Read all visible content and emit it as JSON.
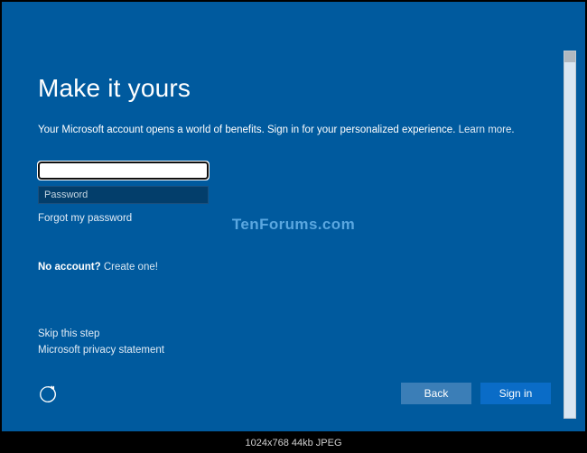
{
  "heading": "Make it yours",
  "subtext_main": "Your Microsoft account opens a world of benefits. Sign in for your personalized experience. ",
  "learn_more": "Learn more",
  "subtext_period": ".",
  "email_value": "",
  "password_placeholder": "Password",
  "forgot": "Forgot my password",
  "no_account_label": "No account? ",
  "create_one": "Create one!",
  "skip": "Skip this step",
  "privacy": "Microsoft privacy statement",
  "back_btn": "Back",
  "signin_btn": "Sign in",
  "watermark": "TenForums.com",
  "footer": "1024x768   44kb   JPEG"
}
